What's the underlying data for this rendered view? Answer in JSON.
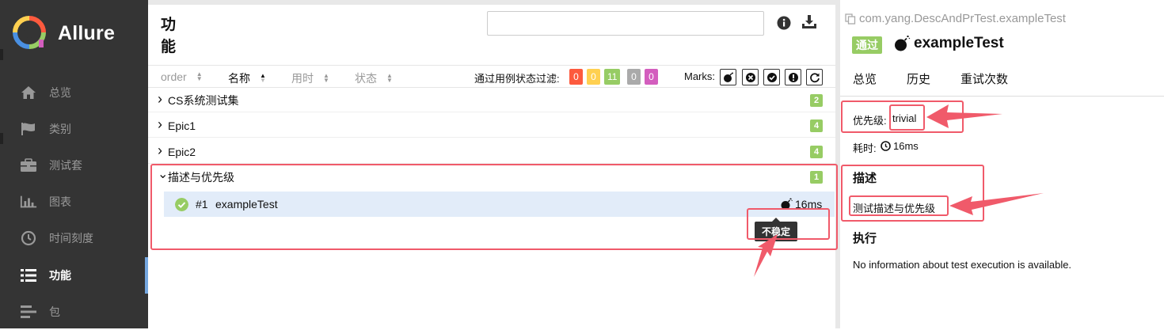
{
  "app": {
    "brand": "Allure"
  },
  "sidebar": {
    "items": [
      {
        "label": "总览",
        "icon": "home-icon"
      },
      {
        "label": "类别",
        "icon": "flag-icon"
      },
      {
        "label": "测试套",
        "icon": "briefcase-icon"
      },
      {
        "label": "图表",
        "icon": "bar-chart-icon"
      },
      {
        "label": "时间刻度",
        "icon": "clock-icon"
      },
      {
        "label": "功能",
        "icon": "list-icon",
        "active": true
      },
      {
        "label": "包",
        "icon": "align-left-icon"
      }
    ]
  },
  "main": {
    "title": "功能",
    "search": {
      "value": "",
      "placeholder": ""
    },
    "columns": {
      "order": "order",
      "name": "名称",
      "duration": "用时",
      "status": "状态"
    },
    "filter_label": "通过用例状态过滤:",
    "status_counts": [
      {
        "value": "0",
        "color": "#fd5a3e"
      },
      {
        "value": "0",
        "color": "#ffd050"
      },
      {
        "value": "11",
        "color": "#97cc64"
      },
      {
        "value": "0",
        "color": "#aaaaaa"
      },
      {
        "value": "0",
        "color": "#d35ebe"
      }
    ],
    "marks_label": "Marks:",
    "marks": [
      "bomb-icon",
      "times-circle-icon",
      "check-circle-icon",
      "exclamation-circle-icon",
      "refresh-icon"
    ],
    "groups": [
      {
        "chevron": ">",
        "label": "CS系统测试集",
        "count": "2"
      },
      {
        "chevron": ">",
        "label": "Epic1",
        "count": "4"
      },
      {
        "chevron": ">",
        "label": "Epic2",
        "count": "4"
      },
      {
        "chevron": "v",
        "label": "描述与优先级",
        "count": "1"
      }
    ],
    "test": {
      "number": "#1",
      "name": "exampleTest",
      "duration": "16ms",
      "tooltip": "不稳定"
    }
  },
  "detail": {
    "path": "com.yang.DescAndPrTest.exampleTest",
    "status": "通过",
    "title": "exampleTest",
    "tabs": [
      "总览",
      "历史",
      "重试次数"
    ],
    "priority_label": "优先级:",
    "priority_value": "trivial",
    "duration_label": "耗时:",
    "duration_value": "16ms",
    "description_heading": "描述",
    "description_text": "测试描述与优先级",
    "execution_heading": "执行",
    "execution_text": "No information about test execution is available."
  },
  "colors": {
    "annotation": "#f05a6a",
    "sidebar_bg": "#343434",
    "passed": "#97cc64",
    "selected_row": "#e2ecf9"
  }
}
